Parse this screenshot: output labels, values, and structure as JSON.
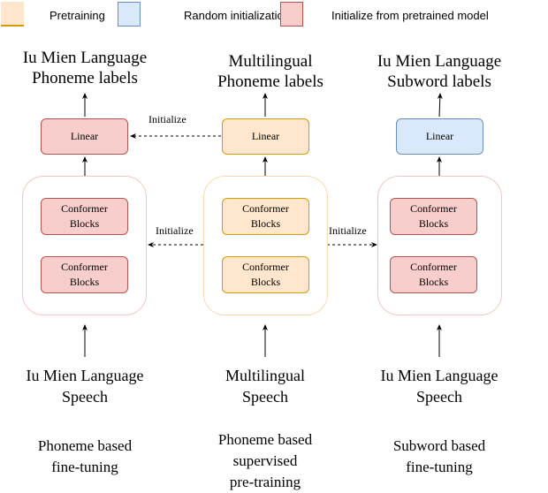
{
  "legend": [
    {
      "label": "Pretraining",
      "fill": "#ffe6cc",
      "stroke": "#d79b00"
    },
    {
      "label": "Random initialization",
      "fill": "#dae8fc",
      "stroke": "#6c8ebf"
    },
    {
      "label": "Initialize from pretrained model",
      "fill": "#f8cecc",
      "stroke": "#b85450"
    }
  ],
  "columns": [
    {
      "output_label": [
        "Iu Mien Language",
        "Phoneme labels"
      ],
      "linear_label": "Linear",
      "blocks": [
        [
          "Conformer",
          "Blocks"
        ],
        [
          "Conformer",
          "Blocks"
        ]
      ],
      "input_label": [
        "Iu Mien Language",
        "Speech"
      ],
      "stage_label": [
        "Phoneme based",
        "fine-tuning"
      ],
      "scheme": "Initialize from pretrained model"
    },
    {
      "output_label": [
        "Multilingual",
        "Phoneme labels"
      ],
      "linear_label": "Linear",
      "blocks": [
        [
          "Conformer",
          "Blocks"
        ],
        [
          "Conformer",
          "Blocks"
        ]
      ],
      "input_label": [
        "Multilingual",
        "Speech"
      ],
      "stage_label": [
        "Phoneme based",
        "supervised",
        "pre-training"
      ],
      "scheme": "Pretraining"
    },
    {
      "output_label": [
        "Iu Mien Language",
        "Subword labels"
      ],
      "linear_label": "Linear",
      "blocks": [
        [
          "Conformer",
          "Blocks"
        ],
        [
          "Conformer",
          "Blocks"
        ]
      ],
      "input_label": [
        "Iu Mien Language",
        "Speech"
      ],
      "stage_label": [
        "Subword based",
        "fine-tuning"
      ],
      "scheme": "Random initialization (linear) / Initialize from pretrained model (blocks)"
    }
  ],
  "connections": {
    "linear_init_label": "Initialize",
    "encoder_init_left_label": "Initialize",
    "encoder_init_right_label": "Initialize"
  },
  "colors": {
    "pretrain_fill": "#ffe6cc",
    "pretrain_stroke": "#d79b00",
    "random_fill": "#dae8fc",
    "random_stroke": "#6c8ebf",
    "init_fill": "#f8cecc",
    "init_stroke": "#b85450",
    "container_pink": "#f4c7c3",
    "container_orange": "#fcd9b0"
  }
}
